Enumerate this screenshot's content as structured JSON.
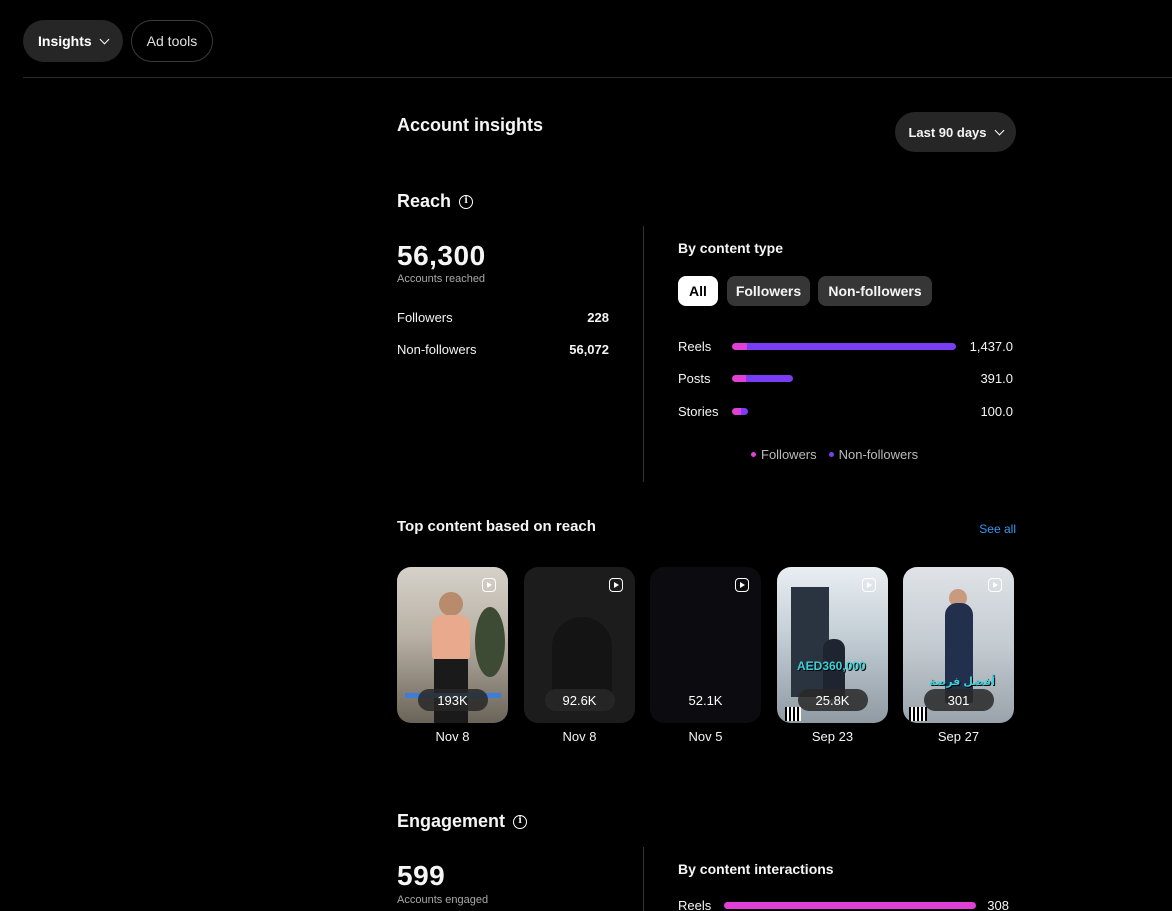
{
  "toolbar": {
    "insights_label": "Insights",
    "ad_tools_label": "Ad tools"
  },
  "header": {
    "title": "Account insights",
    "date_range": "Last 90 days"
  },
  "reach": {
    "title": "Reach",
    "accounts_reached": "56,300",
    "accounts_reached_label": "Accounts reached",
    "rows": [
      {
        "label": "Followers",
        "value": "228"
      },
      {
        "label": "Non-followers",
        "value": "56,072"
      }
    ],
    "by_content_type": {
      "title": "By content type",
      "filters": [
        "All",
        "Followers",
        "Non-followers"
      ],
      "active_filter": "All"
    },
    "legend": {
      "followers": "Followers",
      "non_followers": "Non-followers"
    },
    "colors": {
      "followers": "#e040d6",
      "non_followers": "#7b3cf5"
    }
  },
  "chart_data": {
    "type": "bar",
    "orientation": "horizontal",
    "stacked": true,
    "categories": [
      "Reels",
      "Posts",
      "Stories"
    ],
    "value_labels": [
      "1,437.0",
      "391.0",
      "100.0"
    ],
    "totals": [
      1437.0,
      391.0,
      100.0
    ],
    "series": [
      {
        "name": "Followers",
        "values": [
          95,
          90,
          60
        ]
      },
      {
        "name": "Non-followers",
        "values": [
          1342,
          301,
          40
        ]
      }
    ]
  },
  "top_content": {
    "title": "Top content based on reach",
    "see_all": "See all",
    "items": [
      {
        "count": "193K",
        "date": "Nov 8"
      },
      {
        "count": "92.6K",
        "date": "Nov 8"
      },
      {
        "count": "52.1K",
        "date": "Nov 5"
      },
      {
        "count": "25.8K",
        "date": "Sep 23",
        "overlay_text": "AED360,000"
      },
      {
        "count": "301",
        "date": "Sep 27",
        "overlay_text": "أفضل فرصة"
      }
    ]
  },
  "engagement": {
    "title": "Engagement",
    "accounts_engaged": "599",
    "accounts_engaged_label": "Accounts engaged",
    "interactions_title": "By content interactions",
    "rows": [
      {
        "label": "Reels",
        "value": "308"
      }
    ]
  }
}
